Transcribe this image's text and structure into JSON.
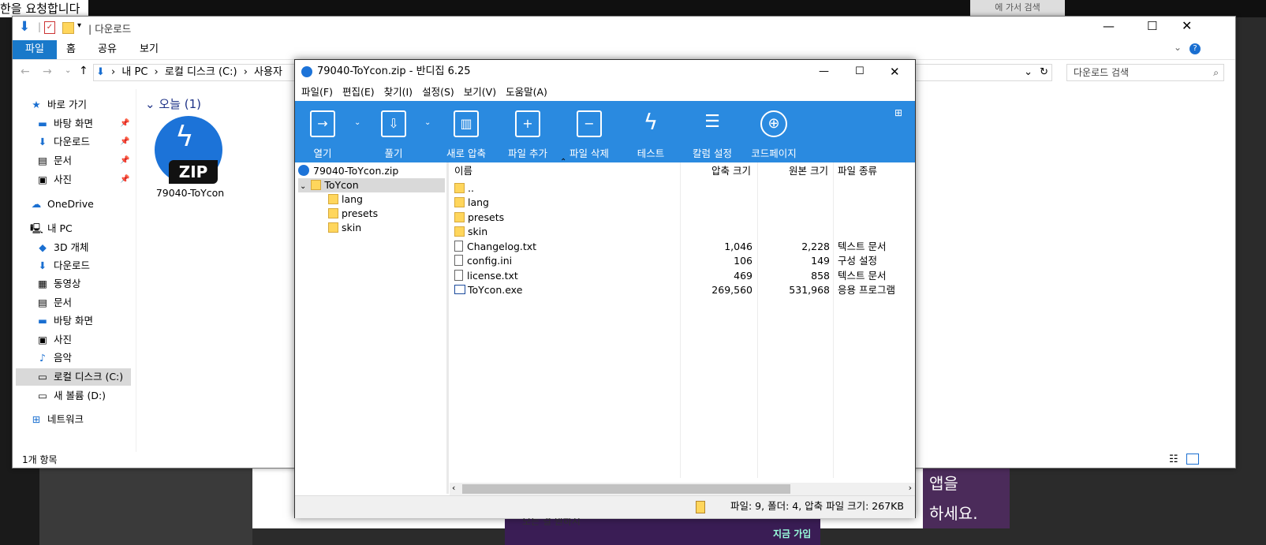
{
  "background": {
    "top_left_text": "한을 요청합니다",
    "top_right_text": "에 가서 검색",
    "promo_lines": [
      "앱을",
      "하세요."
    ],
    "promo_button": "지금 가입",
    "strip_text": "모든 걸 원하시"
  },
  "explorer": {
    "title": "다운로드",
    "qa_separator": "|",
    "ribbon_tabs": [
      "파일",
      "홈",
      "공유",
      "보기"
    ],
    "address": [
      "내 PC",
      "로컬 디스크 (C:)",
      "사용자"
    ],
    "search_placeholder": "다운로드 검색",
    "nav": {
      "quick_access": "바로 가기",
      "quick_items": [
        "바탕 화면",
        "다운로드",
        "문서",
        "사진"
      ],
      "onedrive": "OneDrive",
      "this_pc": "내 PC",
      "pc_items": [
        "3D 개체",
        "다운로드",
        "동영상",
        "문서",
        "바탕 화면",
        "사진",
        "음악",
        "로컬 디스크 (C:)",
        "새 볼륨 (D:)"
      ],
      "network": "네트워크"
    },
    "group_header": "오늘 (1)",
    "file_name": "79040-ToYcon",
    "zip_badge": "ZIP",
    "status": "1개 항목"
  },
  "bandizip": {
    "title": "79040-ToYcon.zip - 반디집 6.25",
    "menu": [
      "파일(F)",
      "편집(E)",
      "찾기(I)",
      "설정(S)",
      "보기(V)",
      "도움말(A)"
    ],
    "toolbar": [
      "열기",
      "풀기",
      "새로 압축",
      "파일 추가",
      "파일 삭제",
      "테스트",
      "칼럼 설정",
      "코드페이지"
    ],
    "tree": {
      "archive": "79040-ToYcon.zip",
      "root": "ToYcon",
      "children": [
        "lang",
        "presets",
        "skin"
      ]
    },
    "columns": [
      "이름",
      "압축 크기",
      "원본 크기",
      "파일 종류"
    ],
    "files": [
      {
        "name": "..",
        "compressed": "",
        "original": "",
        "type": "",
        "kind": "folder"
      },
      {
        "name": "lang",
        "compressed": "",
        "original": "",
        "type": "",
        "kind": "folder"
      },
      {
        "name": "presets",
        "compressed": "",
        "original": "",
        "type": "",
        "kind": "folder"
      },
      {
        "name": "skin",
        "compressed": "",
        "original": "",
        "type": "",
        "kind": "folder"
      },
      {
        "name": "Changelog.txt",
        "compressed": "1,046",
        "original": "2,228",
        "type": "텍스트 문서",
        "kind": "doc"
      },
      {
        "name": "config.ini",
        "compressed": "106",
        "original": "149",
        "type": "구성 설정",
        "kind": "doc"
      },
      {
        "name": "license.txt",
        "compressed": "469",
        "original": "858",
        "type": "텍스트 문서",
        "kind": "doc"
      },
      {
        "name": "ToYcon.exe",
        "compressed": "269,560",
        "original": "531,968",
        "type": "응용 프로그램",
        "kind": "exe"
      }
    ],
    "status": "파일: 9, 폴더: 4, 압축 파일 크기: 267KB"
  }
}
